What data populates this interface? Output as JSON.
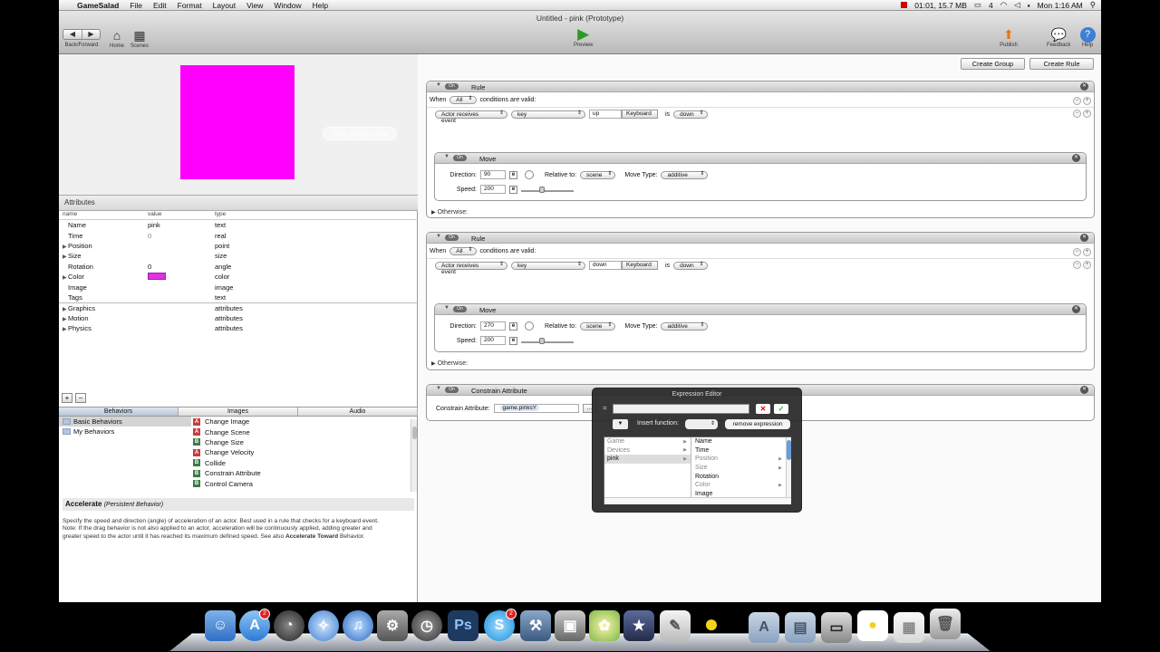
{
  "menubar": {
    "app": "GameSalad",
    "items": [
      "File",
      "Edit",
      "Format",
      "Layout",
      "View",
      "Window",
      "Help"
    ],
    "status": "01:01, 15.7 MB",
    "count": "4",
    "clock": "Mon 1:16 AM"
  },
  "window": {
    "title": "Untitled - pink (Prototype)",
    "back_forward": "Back/Forward",
    "home": "Home",
    "scenes": "Scenes",
    "preview": "Preview",
    "publish": "Publish",
    "feedback": "Feedback",
    "help": "Help"
  },
  "actor_preview": {
    "drag_label": "Drag Image Here",
    "color": "#ff00ff"
  },
  "attributes": {
    "header": "Attributes",
    "columns": [
      "name",
      "value",
      "type"
    ],
    "rows": [
      {
        "name": "Name",
        "value": "pink",
        "type": "text"
      },
      {
        "name": "Time",
        "value": "0",
        "type": "real"
      },
      {
        "name": "Position",
        "value": "",
        "type": "point"
      },
      {
        "name": "Size",
        "value": "",
        "type": "size"
      },
      {
        "name": "Rotation",
        "value": "0",
        "type": "angle"
      },
      {
        "name": "Color",
        "value": "",
        "type": "color"
      },
      {
        "name": "Image",
        "value": "",
        "type": "image"
      },
      {
        "name": "Tags",
        "value": "",
        "type": "text"
      },
      {
        "name": "Graphics",
        "value": "",
        "type": "attributes"
      },
      {
        "name": "Motion",
        "value": "",
        "type": "attributes"
      },
      {
        "name": "Physics",
        "value": "",
        "type": "attributes"
      }
    ]
  },
  "library": {
    "tabs": [
      "Behaviors",
      "Images",
      "Audio"
    ],
    "folders": [
      "Basic Behaviors",
      "My Behaviors"
    ],
    "behaviors": [
      {
        "name": "Change Image",
        "kind": "A"
      },
      {
        "name": "Change Scene",
        "kind": "A"
      },
      {
        "name": "Change Size",
        "kind": "B"
      },
      {
        "name": "Change Velocity",
        "kind": "A"
      },
      {
        "name": "Collide",
        "kind": "B"
      },
      {
        "name": "Constrain Attribute",
        "kind": "B"
      },
      {
        "name": "Control Camera",
        "kind": "B"
      }
    ]
  },
  "description": {
    "title": "Accelerate",
    "subtitle": "(Persistent Behavior)",
    "line1": "Specify the speed and direction (angle) of acceleration of an actor. Best used in a rule that checks for a keyboard event.",
    "line2": "Note: If the drag behavior is not also applied to an actor, acceleration will be continuously applied, adding greater and",
    "line3a": "greater speed to the actor until it has reached its maximum defined speed. See also",
    "line3b": "Accelerate Toward",
    "line3c": "Behavior."
  },
  "editor": {
    "create_group": "Create Group",
    "create_rule": "Create Rule",
    "on": "On",
    "when": "When",
    "all": "All",
    "conditions": "conditions are valid:",
    "is": "is",
    "otherwise": "Otherwise:",
    "rule1": {
      "label": "Rule",
      "event": "Actor receives event",
      "source": "key",
      "key": "up",
      "keyboard": "Keyboard",
      "state": "down",
      "move": {
        "label": "Move",
        "direction_label": "Direction:",
        "direction": "90",
        "relative_label": "Relative to:",
        "relative": "scene",
        "movetype_label": "Move Type:",
        "movetype": "additive",
        "speed_label": "Speed:",
        "speed": "200"
      }
    },
    "rule2": {
      "label": "Rule",
      "event": "Actor receives event",
      "source": "key",
      "key": "down",
      "keyboard": "Keyboard",
      "state": "down",
      "move": {
        "label": "Move",
        "direction_label": "Direction:",
        "direction": "270",
        "relative_label": "Relative to:",
        "relative": "scene",
        "movetype_label": "Move Type:",
        "movetype": "additive",
        "speed_label": "Speed:",
        "speed": "200"
      }
    },
    "constrain": {
      "label": "Constrain Attribute",
      "field_label": "Constrain Attribute:",
      "value": "game.pinksY"
    }
  },
  "expression_editor": {
    "title": "Expression Editor",
    "eq": "=",
    "insert_function": "Insert function:",
    "remove": "remove expression",
    "col1": [
      {
        "label": "Game",
        "gray": true
      },
      {
        "label": "Devices",
        "gray": true
      },
      {
        "label": "pink",
        "gray": false,
        "sel": true
      }
    ],
    "col2": [
      {
        "label": "Name",
        "gray": false,
        "more": false
      },
      {
        "label": "Time",
        "gray": false,
        "more": false
      },
      {
        "label": "Position",
        "gray": true,
        "more": true
      },
      {
        "label": "Size",
        "gray": true,
        "more": true
      },
      {
        "label": "Rotation",
        "gray": false,
        "more": false
      },
      {
        "label": "Color",
        "gray": true,
        "more": true
      },
      {
        "label": "Image",
        "gray": false,
        "more": false
      }
    ]
  },
  "dock": {
    "badges": {
      "app_store": "2",
      "skype": "2"
    },
    "ps_label": "Ps"
  }
}
